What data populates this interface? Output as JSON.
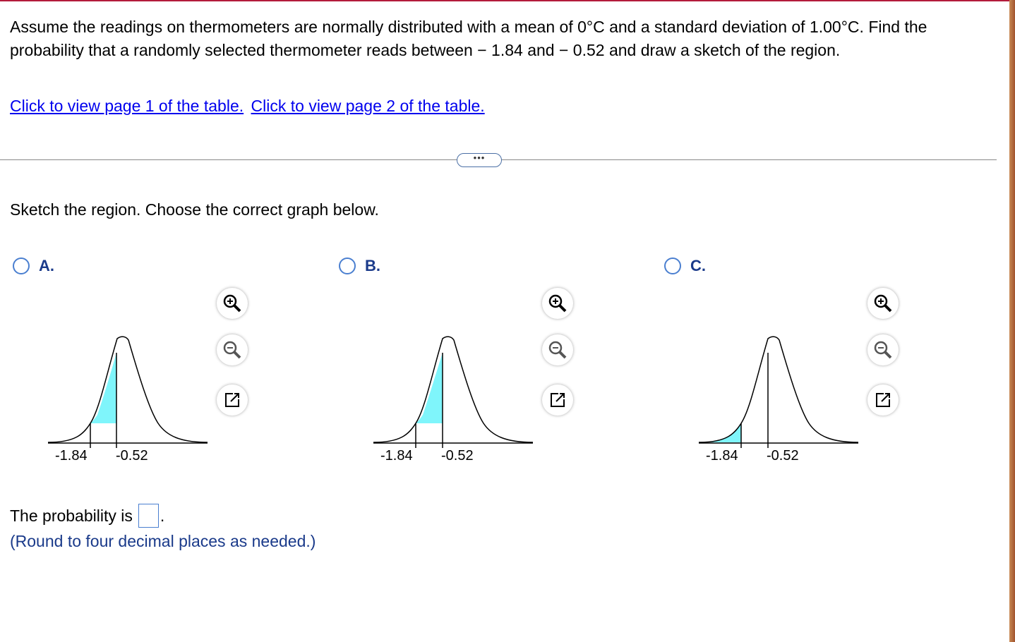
{
  "question": {
    "line1": "Assume the readings on thermometers are normally distributed with a mean of 0°C and a standard deviation of 1.00°C. Find the probability that a randomly selected thermometer reads between − 1.84 and − 0.52 and draw a sketch of the region."
  },
  "links": {
    "page1": "Click to view page 1 of the table.",
    "page2": "Click to view page 2 of the table."
  },
  "expand_label": "•••",
  "instruction": "Sketch the region. Choose the correct graph below.",
  "options": [
    {
      "label": "A.",
      "ticks": [
        "-1.84",
        "-0.52"
      ]
    },
    {
      "label": "B.",
      "ticks": [
        "-1.84",
        "-0.52"
      ]
    },
    {
      "label": "C.",
      "ticks": [
        "-1.84",
        "-0.52"
      ]
    }
  ],
  "tools": [
    "zoom-in-icon",
    "zoom-out-icon",
    "popout-icon"
  ],
  "answer": {
    "prefix": "The probability is",
    "value": "",
    "suffix": ".",
    "note": "(Round to four decimal places as needed.)"
  },
  "colors": {
    "shade": "#7ff5fb",
    "link": "#0000ee",
    "note": "#1a3a8a",
    "radio": "#4a7fd0"
  }
}
